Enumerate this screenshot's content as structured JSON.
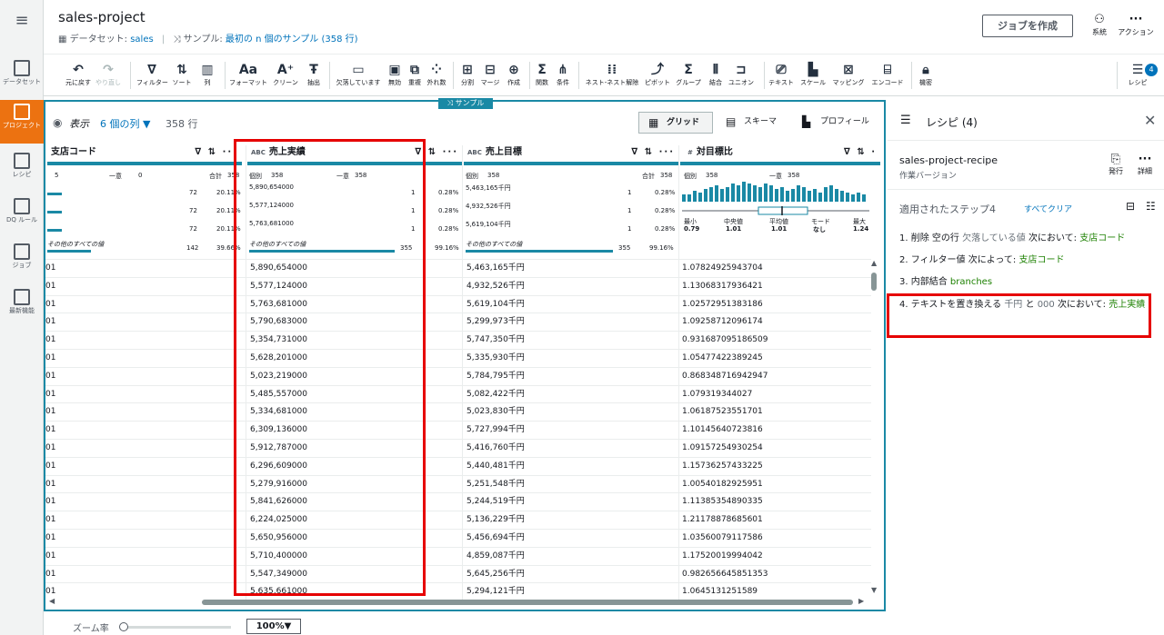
{
  "nav": {
    "items": [
      {
        "label": "データセット",
        "icon": "table-icon"
      },
      {
        "label": "プロジェクト",
        "icon": "grid-icon"
      },
      {
        "label": "レシピ",
        "icon": "list-icon"
      },
      {
        "label": "DQ ルール",
        "icon": "dq-icon"
      },
      {
        "label": "ジョブ",
        "icon": "play-icon"
      },
      {
        "label": "最新機能",
        "icon": "news-icon"
      }
    ]
  },
  "header": {
    "title": "sales-project",
    "dataset_prefix": "データセット:",
    "dataset_name": "sales",
    "sample_prefix": "サンプル:",
    "sample_value": "最初の n 個のサンプル (358 行)",
    "create_job": "ジョブを作成",
    "lineage": "系統",
    "actions": "アクション"
  },
  "toolbar": {
    "undo": "元に戻す",
    "redo": "やり直し",
    "filter": "フィルター",
    "sort": "ソート",
    "column": "列",
    "format": "フォーマット",
    "clean": "クリーン",
    "extract": "抽出",
    "missing": "欠落しています",
    "invalid": "無効",
    "duplicate": "重複",
    "outlier": "外れ数",
    "split": "分割",
    "merge": "マージ",
    "create": "作成",
    "function": "関数",
    "condition": "条件",
    "nest": "ネスト-ネスト解除",
    "pivot": "ピボット",
    "group": "グループ",
    "join": "結合",
    "union": "ユニオン",
    "text": "テキスト",
    "scale": "スケール",
    "mapping": "マッピング",
    "encode": "エンコード",
    "sensitive": "機密",
    "recipe": "レシピ",
    "recipe_count": "4"
  },
  "grid": {
    "sample_tag": "サンプル",
    "view_label": "表示",
    "columns_count": "6 個の列",
    "rows_count": "358 行",
    "mode_grid": "グリッド",
    "mode_schema": "スキーマ",
    "mode_profile": "プロフィール",
    "columns": [
      {
        "type": "",
        "name": "支店コード"
      },
      {
        "type": "ABC",
        "name": "売上実績"
      },
      {
        "type": "ABC",
        "name": "売上目標"
      },
      {
        "type": "#",
        "name": "対目標比"
      }
    ],
    "stats": {
      "c0_left": "5",
      "c0_unique_label": "一意",
      "c0_unique": "0",
      "c0_total_label": "合計",
      "c0_total": "358",
      "c0_vals": [
        "72",
        "72",
        "72",
        "142"
      ],
      "c0_pcts": [
        "20.11%",
        "20.11%",
        "20.11%",
        "39.66%"
      ],
      "c0_other": "その他のすべての値",
      "c1_distinct_label": "個別",
      "c1_distinct": "358",
      "c1_unique_label": "一意",
      "c1_unique": "358",
      "c1_vals": [
        "5,890,654000",
        "5,577,124000",
        "5,763,681000"
      ],
      "c1_counts": [
        "1",
        "1",
        "1"
      ],
      "c1_other": "その他のすべての値",
      "c1_other_count": "355",
      "c1_other_pct": "99.16%",
      "c2_distinct_label": "個別",
      "c2_distinct": "358",
      "c2_total_label": "合計",
      "c2_total": "358",
      "c2_vals": [
        "5,463,165千円",
        "4,932,526千円",
        "5,619,104千円"
      ],
      "c2_counts": [
        "1",
        "1",
        "1"
      ],
      "c2_pcts": [
        "0.28%",
        "0.28%",
        "0.28%"
      ],
      "c2_other": "その他のすべての値",
      "c2_other_count": "355",
      "c2_other_pct": "99.16%",
      "c1_pcts": [
        "0.28%",
        "0.28%",
        "0.28%"
      ],
      "c3_distinct_label": "個別",
      "c3_distinct": "358",
      "c3_unique_label": "一意",
      "c3_unique": "358",
      "c3_labels": [
        "最小",
        "中央値",
        "平均値",
        "モード",
        "最大"
      ],
      "c3_values": [
        "0.79",
        "1.01",
        "1.01",
        "なし",
        "1.24"
      ]
    },
    "rows": [
      [
        "01",
        "5,890,654000",
        "5,463,165千円",
        "1.07824925943704"
      ],
      [
        "01",
        "5,577,124000",
        "4,932,526千円",
        "1.13068317936421"
      ],
      [
        "01",
        "5,763,681000",
        "5,619,104千円",
        "1.02572951383186"
      ],
      [
        "01",
        "5,790,683000",
        "5,299,973千円",
        "1.09258712096174"
      ],
      [
        "01",
        "5,354,731000",
        "5,747,350千円",
        "0.931687095186509"
      ],
      [
        "01",
        "5,628,201000",
        "5,335,930千円",
        "1.05477422389245"
      ],
      [
        "01",
        "5,023,219000",
        "5,784,795千円",
        "0.868348716942947"
      ],
      [
        "01",
        "5,485,557000",
        "5,082,422千円",
        "1.079319344027"
      ],
      [
        "01",
        "5,334,681000",
        "5,023,830千円",
        "1.06187523551701"
      ],
      [
        "01",
        "6,309,136000",
        "5,727,994千円",
        "1.10145640723816"
      ],
      [
        "01",
        "5,912,787000",
        "5,416,760千円",
        "1.09157254930254"
      ],
      [
        "01",
        "6,296,609000",
        "5,440,481千円",
        "1.15736257433225"
      ],
      [
        "01",
        "5,279,916000",
        "5,251,548千円",
        "1.00540182925951"
      ],
      [
        "01",
        "5,841,626000",
        "5,244,519千円",
        "1.11385354890335"
      ],
      [
        "01",
        "6,224,025000",
        "5,136,229千円",
        "1.21178878685601"
      ],
      [
        "01",
        "5,650,956000",
        "5,456,694千円",
        "1.03560079117586"
      ],
      [
        "01",
        "5,710,400000",
        "4,859,087千円",
        "1.17520019994042"
      ],
      [
        "01",
        "5,547,349000",
        "5,645,256千円",
        "0.982656645851353"
      ],
      [
        "01",
        "5,635,661000",
        "5,294,121千円",
        "1.0645131251589"
      ]
    ]
  },
  "recipe": {
    "title": "レシピ (4)",
    "name": "sales-project-recipe",
    "version": "作業バージョン",
    "publish": "発行",
    "details": "詳細",
    "steps_heading": "適用されたステップ4",
    "clear_all": "すべてクリア",
    "steps": [
      {
        "a": "1. 削除 空の行",
        "m": "欠落している値",
        "b": "次において:",
        "g": "支店コード"
      },
      {
        "a": "2. フィルター値",
        "m": "",
        "b": "次によって:",
        "g": "支店コード"
      },
      {
        "a": "3. 内部結合",
        "m": "",
        "b": "",
        "g": "branches"
      },
      {
        "a": "4. テキストを置き換える",
        "m": "千円",
        "b": "と",
        "m2": "000",
        "b2": "次において:",
        "g": "売上実績"
      }
    ]
  },
  "zoom": {
    "label": "ズーム率",
    "value": "100%▼"
  }
}
